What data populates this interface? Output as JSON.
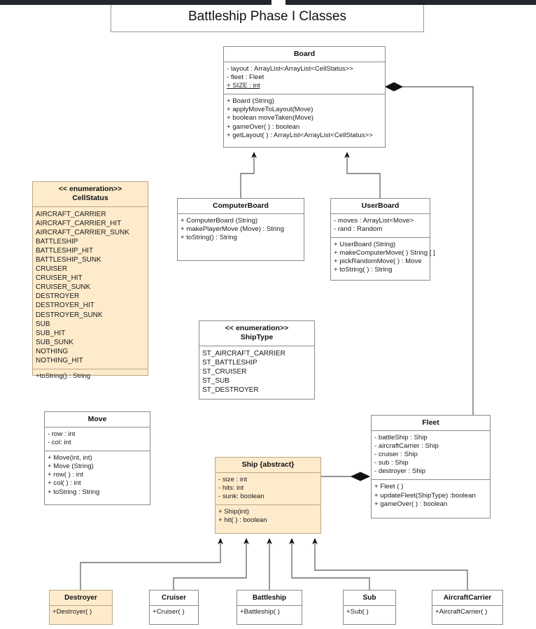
{
  "diagram": {
    "title": "Battleship Phase I Classes",
    "type": "UML class diagram",
    "colors": {
      "highlight_fill": "#fdebcb",
      "highlight_border": "#b9a885",
      "plain_fill": "#ffffff",
      "border": "#8a8a8a",
      "text": "#1a1a1a",
      "topbar": "#23272b"
    }
  },
  "classes": {
    "board": {
      "name": "Board",
      "attributes": [
        "- layout : ArrayList<ArrayList<CellStatus>>",
        "- fleet : Fleet",
        "+ SIZE : int"
      ],
      "static_attribute": "+ SIZE : int",
      "methods": [
        "+ Board (String)",
        "+ applyMoveToLayout(Move)",
        "+ boolean moveTaken(Move)",
        "+ gameOver( ) : boolean",
        "+ getLayout( ) : ArrayList<ArrayList<CellStatus>>"
      ]
    },
    "cellstatus": {
      "stereotype": "<< enumeration>>",
      "name": "CellStatus",
      "literals": [
        "AIRCRAFT_CARRIER",
        "AIRCRAFT_CARRIER_HIT",
        "AIRCRAFT_CARRIER_SUNK",
        "BATTLESHIP",
        "BATTLESHIP_HIT",
        "BATTLESHIP_SUNK",
        "CRUISER",
        "CRUISER_HIT",
        "CRUISER_SUNK",
        "DESTROYER",
        "DESTROYER_HIT",
        "DESTROYER_SUNK",
        "SUB",
        "SUB_HIT",
        "SUB_SUNK",
        "NOTHING",
        "NOTHING_HIT"
      ],
      "methods": [
        "+toString() : String"
      ]
    },
    "computerboard": {
      "name": "ComputerBoard",
      "methods": [
        "+ ComputerBoard (String)",
        "+ makePlayerMove (Move) : String",
        "+ toString() : String"
      ]
    },
    "userboard": {
      "name": "UserBoard",
      "attributes": [
        "- moves : ArrayList<Move>",
        "- rand : Random"
      ],
      "methods": [
        "+ UserBoard (String)",
        "+ makeComputerMove( ) String [ ]",
        "+ pickRandomMove( ) : Move",
        "+ toString( ) : String"
      ]
    },
    "shiptype": {
      "stereotype": "<< enumeration>>",
      "name": "ShipType",
      "literals": [
        "ST_AIRCRAFT_CARRIER",
        "ST_BATTLESHIP",
        "ST_CRUISER",
        "ST_SUB",
        "ST_DESTROYER"
      ]
    },
    "move": {
      "name": "Move",
      "attributes": [
        "- row : int",
        "- col: int"
      ],
      "methods": [
        "+ Move(int, int)",
        "+ Move (String)",
        "+ row( ) : int",
        "+ col( ) : int",
        "+ toString : String"
      ]
    },
    "fleet": {
      "name": "Fleet",
      "attributes": [
        "- battleShip : Ship",
        "- aircraftCarrier : Ship",
        "- cruiser : Ship",
        "- sub : Ship",
        "- destroyer : Ship"
      ],
      "methods": [
        "+ Fleet ( )",
        "+ updateFleet(ShipType) :boolean",
        "+ gameOver( ) : boolean"
      ]
    },
    "ship": {
      "name": "Ship {abstract}",
      "attributes": [
        "- size : int",
        "- hits: int",
        "- sunk: boolean"
      ],
      "methods": [
        "+ Ship(int)",
        "+ hit( ) : boolean"
      ]
    },
    "destroyer": {
      "name": "Destroyer",
      "methods": [
        "+Destroyer( )"
      ]
    },
    "cruiser": {
      "name": "Cruiser",
      "methods": [
        "+Cruiser( )"
      ]
    },
    "battleship": {
      "name": "Battleship",
      "methods": [
        "+Battleship( )"
      ]
    },
    "sub": {
      "name": "Sub",
      "methods": [
        "+Sub( )"
      ]
    },
    "aircraftcarrier": {
      "name": "AircraftCarrier",
      "methods": [
        "+AircraftCarrier( )"
      ]
    }
  },
  "relationships": [
    {
      "kind": "composition",
      "from": "Fleet",
      "to": "Board",
      "marker": "filled-diamond"
    },
    {
      "kind": "composition",
      "from": "Ship",
      "to": "Fleet",
      "marker": "filled-diamond"
    },
    {
      "kind": "generalization",
      "from": "ComputerBoard",
      "to": "Board",
      "marker": "arrow"
    },
    {
      "kind": "generalization",
      "from": "UserBoard",
      "to": "Board",
      "marker": "arrow"
    },
    {
      "kind": "generalization",
      "from": "Destroyer",
      "to": "Ship",
      "marker": "arrow"
    },
    {
      "kind": "generalization",
      "from": "Cruiser",
      "to": "Ship",
      "marker": "arrow"
    },
    {
      "kind": "generalization",
      "from": "Battleship",
      "to": "Ship",
      "marker": "arrow"
    },
    {
      "kind": "generalization",
      "from": "Sub",
      "to": "Ship",
      "marker": "arrow"
    },
    {
      "kind": "generalization",
      "from": "AircraftCarrier",
      "to": "Ship",
      "marker": "arrow"
    }
  ]
}
